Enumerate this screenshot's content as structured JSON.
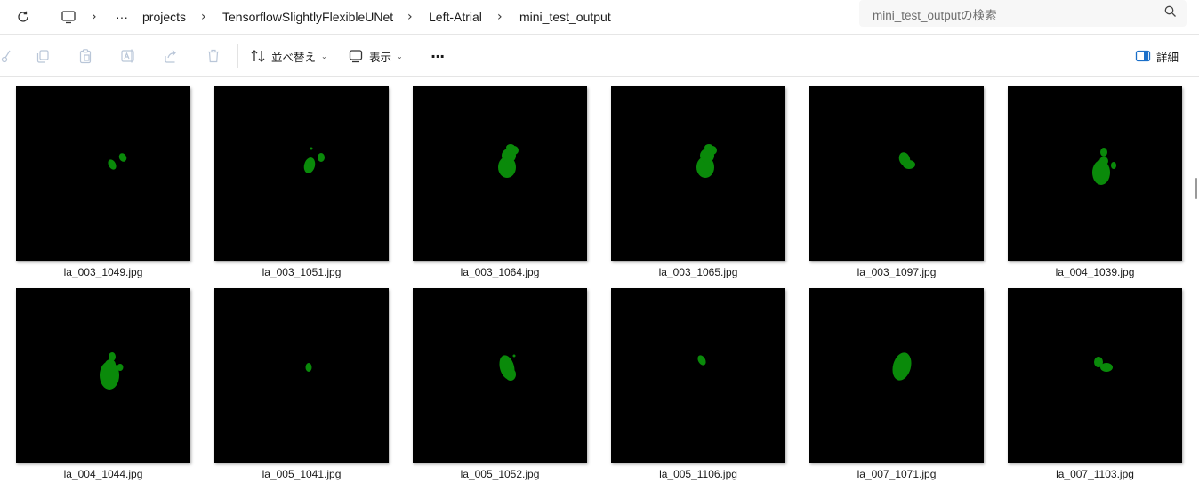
{
  "breadcrumb": {
    "more": "···",
    "items": [
      "projects",
      "TensorflowSlightlyFlexibleUNet",
      "Left-Atrial",
      "mini_test_output"
    ]
  },
  "search": {
    "placeholder": "mini_test_outputの検索"
  },
  "toolbar": {
    "sort_label": "並べ替え",
    "view_label": "表示",
    "more_label": "···",
    "details_label": "詳細"
  },
  "colors": {
    "mask_green": "#0a8a0a",
    "thumb_bg": "#000000"
  },
  "files": [
    {
      "name": "la_003_1049.jpg"
    },
    {
      "name": "la_003_1051.jpg"
    },
    {
      "name": "la_003_1064.jpg"
    },
    {
      "name": "la_003_1065.jpg"
    },
    {
      "name": "la_003_1097.jpg"
    },
    {
      "name": "la_004_1039.jpg"
    },
    {
      "name": "la_004_1044.jpg"
    },
    {
      "name": "la_005_1041.jpg"
    },
    {
      "name": "la_005_1052.jpg"
    },
    {
      "name": "la_005_1106.jpg"
    },
    {
      "name": "la_007_1071.jpg"
    },
    {
      "name": "la_007_1103.jpg"
    }
  ]
}
